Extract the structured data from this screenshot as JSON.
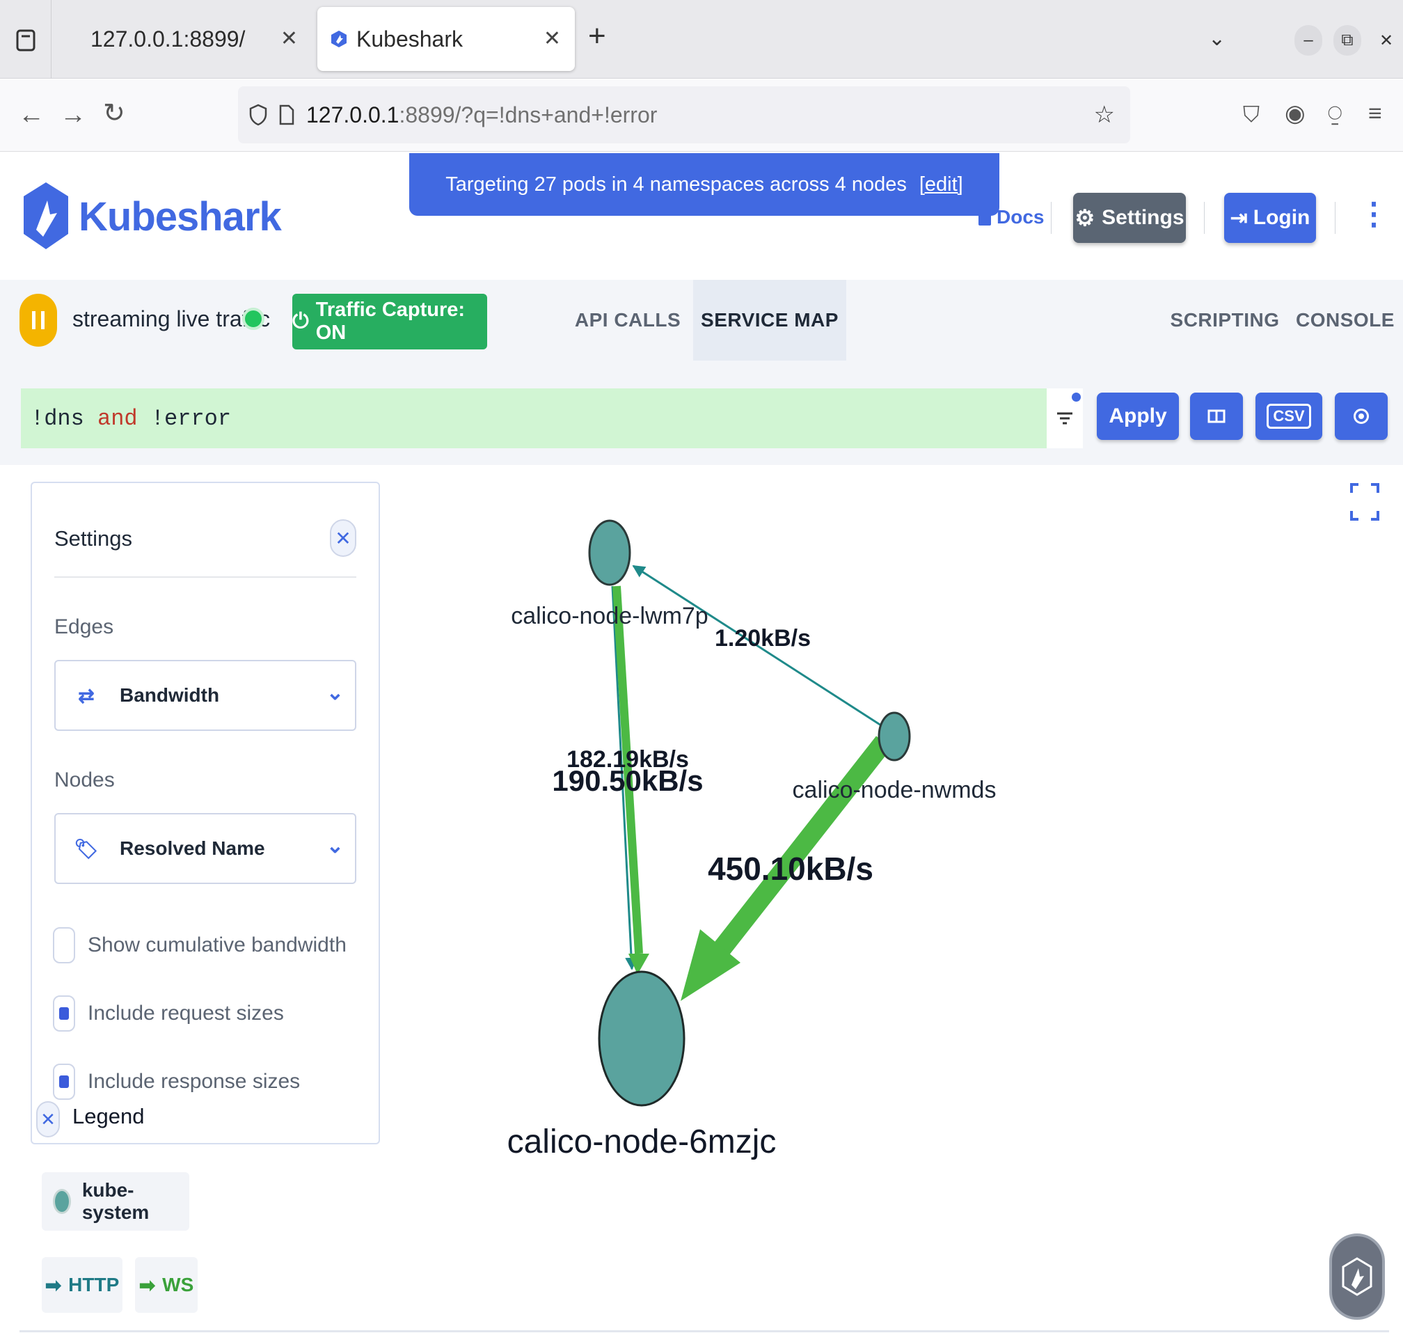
{
  "browser": {
    "tabs": [
      {
        "title": "127.0.0.1:8899/",
        "active": false
      },
      {
        "title": "Kubeshark",
        "active": true
      }
    ],
    "new_tab_symbol": "+",
    "url": {
      "host": "127.0.0.1",
      "rest": ":8899/?q=!dns+and+!error"
    }
  },
  "header": {
    "brand": "Kubeshark",
    "banner": {
      "text": "Targeting 27 pods in 4 namespaces across 4 nodes",
      "edit": "[edit]"
    },
    "docs": "Docs",
    "settings": "Settings",
    "login": "Login"
  },
  "toolbar": {
    "stream_text": "streaming live traffic",
    "capture": "Traffic Capture: ON",
    "tabs": {
      "api_calls": "API CALLS",
      "service_map": "SERVICE MAP",
      "scripting": "SCRIPTING",
      "console": "CONSOLE"
    },
    "active_tab": "SERVICE MAP"
  },
  "query": {
    "part1": "!dns ",
    "keyword": "and",
    "part2": " !error",
    "apply": "Apply",
    "csv": "CSV"
  },
  "settings_panel": {
    "title": "Settings",
    "edges_label": "Edges",
    "edges_value": "Bandwidth",
    "nodes_label": "Nodes",
    "nodes_value": "Resolved Name",
    "checkboxes": [
      {
        "label": "Show cumulative bandwidth",
        "checked": false
      },
      {
        "label": "Include request sizes",
        "checked": true
      },
      {
        "label": "Include response sizes",
        "checked": true
      }
    ]
  },
  "legend": {
    "title": "Legend",
    "namespace": "kube-system",
    "namespace_color": "#5aa39e",
    "protocols": [
      {
        "name": "HTTP",
        "color": "#1f7a86"
      },
      {
        "name": "WS",
        "color": "#3aa13a"
      }
    ]
  },
  "service_map": {
    "nodes": [
      {
        "id": "lwm7p",
        "label": "calico-node-lwm7p"
      },
      {
        "id": "nwmds",
        "label": "calico-node-nwmds"
      },
      {
        "id": "6mzjc",
        "label": "calico-node-6mzjc"
      }
    ],
    "edges": [
      {
        "from": "nwmds",
        "to": "lwm7p",
        "label": "1.20kB/s",
        "protocol": "HTTP"
      },
      {
        "from": "lwm7p",
        "to": "6mzjc",
        "label": "182.19kB/s",
        "protocol": "HTTP"
      },
      {
        "from": "lwm7p",
        "to": "6mzjc",
        "label": "190.50kB/s",
        "protocol": "WS"
      },
      {
        "from": "nwmds",
        "to": "6mzjc",
        "label": "450.10kB/s",
        "protocol": "WS"
      }
    ]
  },
  "colors": {
    "accent": "#4169e1",
    "capture_green": "#27ae60",
    "query_bg": "#d1f5d3",
    "node_fill": "#5aa39e",
    "ws_edge": "#4cb944",
    "http_edge": "#1f8a8a"
  }
}
